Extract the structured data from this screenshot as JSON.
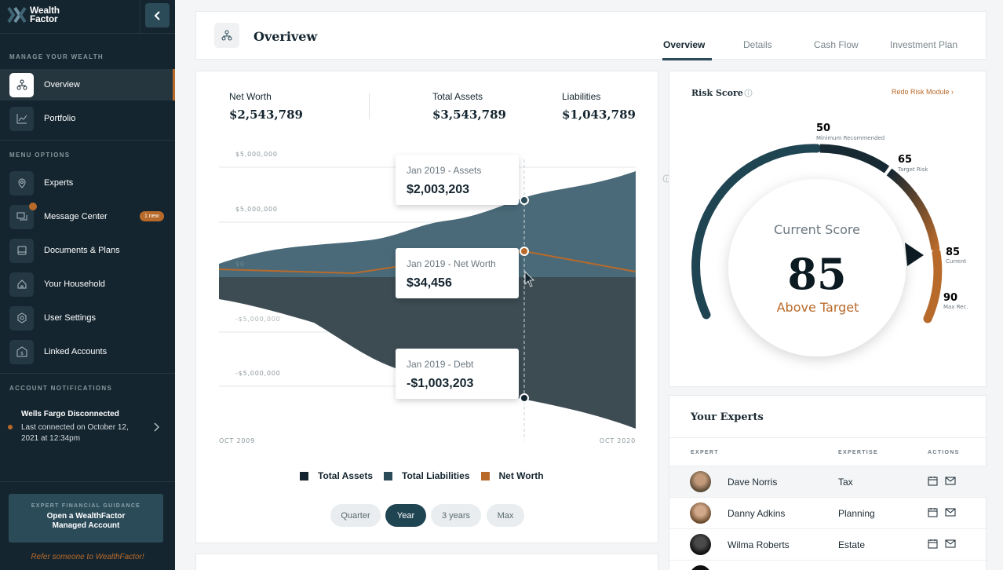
{
  "brand": {
    "line1": "Wealth",
    "line2": "Factor"
  },
  "sidebar": {
    "manage_header": "MANAGE YOUR WEALTH",
    "menu_header": "MENU OPTIONS",
    "notifications_header": "ACCOUNT NOTIFICATIONS",
    "items": [
      {
        "label": "Overview",
        "icon": "overview-icon"
      },
      {
        "label": "Portfolio",
        "icon": "portfolio-icon"
      },
      {
        "label": "Experts",
        "icon": "experts-icon"
      },
      {
        "label": "Message Center",
        "icon": "message-icon",
        "badge": "1 new"
      },
      {
        "label": "Documents & Plans",
        "icon": "documents-icon"
      },
      {
        "label": "Your Household",
        "icon": "household-icon"
      },
      {
        "label": "User Settings",
        "icon": "settings-icon"
      },
      {
        "label": "Linked Accounts",
        "icon": "linked-accounts-icon"
      }
    ],
    "notification": {
      "title": "Wells Fargo Disconnected",
      "body": "Last connected on October 12, 2021 at 12:34pm"
    },
    "cta": {
      "kicker": "EXPERT FINANCIAL GUIDANCE",
      "line1": "Open a WealthFactor",
      "line2": "Managed Account"
    },
    "refer": "Refer someone to WealthFactor!"
  },
  "header": {
    "title": "Overivew",
    "tabs": [
      "Overview",
      "Details",
      "Cash Flow",
      "Investment Plan"
    ],
    "active_tab": "Overview"
  },
  "stats": {
    "net_worth_label": "Net Worth",
    "net_worth": "$2,543,789",
    "total_assets_label": "Total Assets",
    "total_assets": "$3,543,789",
    "liabilities_label": "Liabilities",
    "liabilities": "$1,043,789"
  },
  "chart_data": {
    "type": "area",
    "x_start_label": "OCT 2009",
    "x_end_label": "OCT 2020",
    "y_tick_labels": [
      "$5,000,000",
      "$5,000,000",
      "$0",
      "-$5,000,000",
      "-$5,000,000"
    ],
    "series": [
      {
        "name": "Total Assets",
        "color": "#4a6a79"
      },
      {
        "name": "Total Liabilities",
        "color": "#3d4c53"
      },
      {
        "name": "Net Worth",
        "color": "#b86a2b"
      }
    ],
    "tooltips": [
      {
        "label": "Jan 2019 - Assets",
        "value": "$2,003,203"
      },
      {
        "label": "Jan 2019 - Net Worth",
        "value": "$34,456"
      },
      {
        "label": "Jan 2019 - Debt",
        "value": "-$1,003,203"
      }
    ],
    "legend": [
      {
        "name": "Total Assets",
        "color": "#14252f"
      },
      {
        "name": "Total Liabilities",
        "color": "#2c4b59"
      },
      {
        "name": "Net Worth",
        "color": "#b86a2b"
      }
    ]
  },
  "ranges": [
    "Quarter",
    "Year",
    "3 years",
    "Max"
  ],
  "active_range": "Year",
  "risk": {
    "title": "Risk Score",
    "redo": "Redo Risk Module ›",
    "current_score_label": "Current Score",
    "score": "85",
    "status": "Above Target",
    "markers": [
      {
        "value": "50",
        "label": "Minimum Recommended"
      },
      {
        "value": "65",
        "label": "Target Risk"
      },
      {
        "value": "85",
        "label": "Current"
      },
      {
        "value": "90",
        "label": "Max Rec."
      }
    ]
  },
  "experts": {
    "title": "Your Experts",
    "columns": [
      "EXPERT",
      "EXPERTISE",
      "ACTIONS"
    ],
    "rows": [
      {
        "name": "Dave Norris",
        "expertise": "Tax"
      },
      {
        "name": "Danny Adkins",
        "expertise": "Planning"
      },
      {
        "name": "Wilma Roberts",
        "expertise": "Estate"
      }
    ]
  }
}
